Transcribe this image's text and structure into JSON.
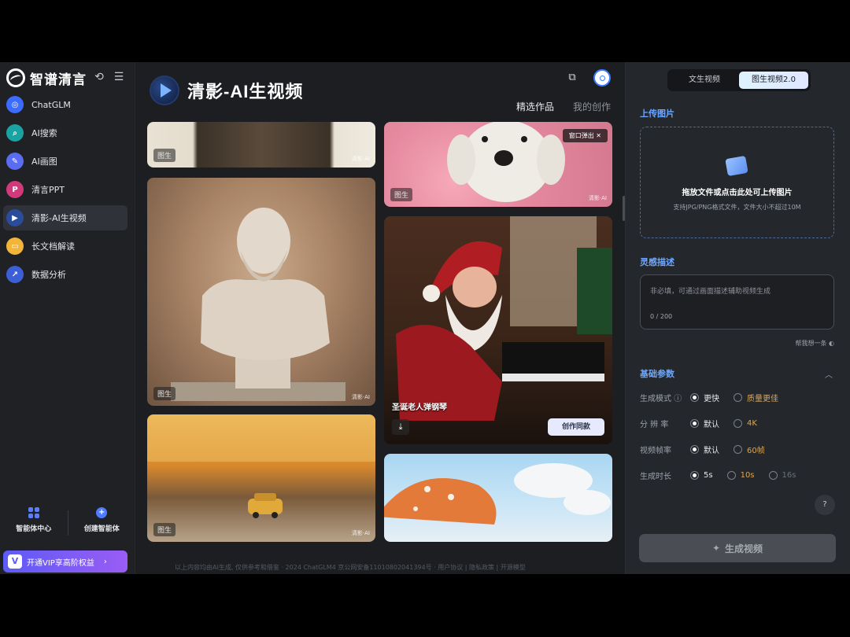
{
  "brand": {
    "name": "智谱清言"
  },
  "sidebar": {
    "items": [
      {
        "label": "ChatGLM",
        "icon": "chatglm-icon",
        "color": "#3b6cff"
      },
      {
        "label": "AI搜索",
        "icon": "ai-search-icon",
        "color": "#1aa3a3"
      },
      {
        "label": "AI画图",
        "icon": "ai-draw-icon",
        "color": "#5a6cf0"
      },
      {
        "label": "清言PPT",
        "icon": "ppt-icon",
        "color": "#d13a7a"
      },
      {
        "label": "清影-AI生视频",
        "icon": "qingying-icon",
        "color": "#2b4c9a"
      },
      {
        "label": "长文档解读",
        "icon": "folder-icon",
        "color": "#f2b53a"
      },
      {
        "label": "数据分析",
        "icon": "chart-icon",
        "color": "#3c5fd6"
      }
    ],
    "agent_center": "智能体中心",
    "create_agent": "创建智能体",
    "vip": "开通VIP享高阶权益"
  },
  "main": {
    "title": "清影-AI生视频",
    "tabs": [
      "精选作品",
      "我的创作"
    ],
    "cards": {
      "badge": "图生",
      "watermark": "清影·AI",
      "popup": "窗口弹出",
      "caption": "圣诞老人弹钢琴",
      "same_style": "创作同款"
    },
    "footer": "以上内容均由AI生成, 仅供参考和借鉴 · 2024 ChatGLM4 京公网安备11010802041394号 · 用户协议 | 隐私政策 | 开源模型"
  },
  "panel": {
    "modes": [
      "文生视频",
      "图生视频2.0"
    ],
    "upload_title": "上传图片",
    "upload_main": "拖放文件或点击此处可上传图片",
    "upload_sub": "支持JPG/PNG格式文件，文件大小不超过10M",
    "desc_title": "灵感描述",
    "desc_placeholder": "非必填，可通过画面描述辅助视频生成",
    "desc_count": "0 / 200",
    "help": "帮我想一条",
    "params_title": "基础参数",
    "params": [
      {
        "label": "生成模式",
        "options": [
          "更快",
          "质量更佳"
        ]
      },
      {
        "label": "分 辨 率",
        "options": [
          "默认",
          "4K"
        ]
      },
      {
        "label": "视频帧率",
        "options": [
          "默认",
          "60帧"
        ]
      },
      {
        "label": "生成时长",
        "options": [
          "5s",
          "10s",
          "16s"
        ]
      }
    ],
    "generate": "生成视频"
  }
}
